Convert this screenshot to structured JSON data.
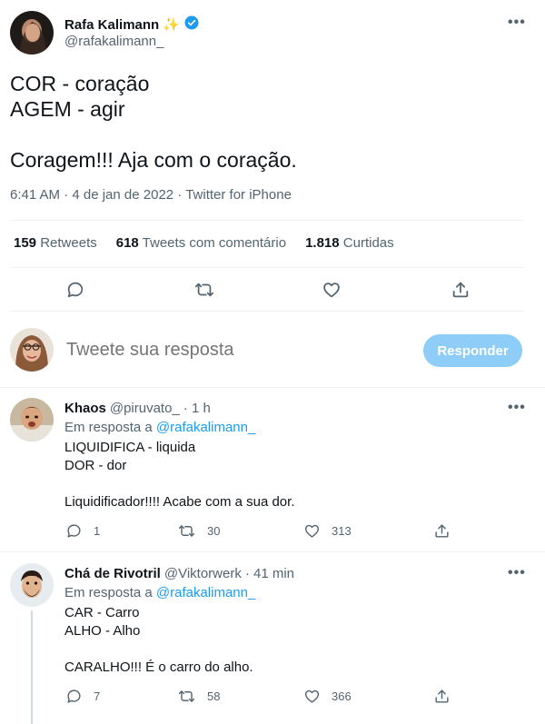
{
  "main_tweet": {
    "name": "Rafa Kalimann",
    "name_emoji": "✨",
    "handle": "@rafakalimann_",
    "text": "COR - coração\nAGEM - agir\n\nCoragem!!! Aja com o coração.",
    "timestamp": "6:41 AM · 4 de jan de 2022 · ",
    "source": "Twitter for iPhone",
    "stats": {
      "retweets_count": "159",
      "retweets_label": "Retweets",
      "quotes_count": "618",
      "quotes_label": "Tweets com comentário",
      "likes_count": "1.818",
      "likes_label": "Curtidas"
    }
  },
  "composer": {
    "placeholder": "Tweete sua resposta",
    "button_label": "Responder"
  },
  "replies": [
    {
      "name": "Khaos",
      "handle": "@piruvato_",
      "time": "· 1 h",
      "in_reply_prefix": "Em resposta a ",
      "in_reply_to": "@rafakalimann_",
      "text": "LIQUIDIFICA - liquida\nDOR - dor\n\nLiquidificador!!!! Acabe com a sua dor.",
      "replies": "1",
      "retweets": "30",
      "likes": "313"
    },
    {
      "name": "Chá de Rivotril",
      "handle": "@Viktorwerk",
      "time": "· 41 min",
      "in_reply_prefix": "Em resposta a ",
      "in_reply_to": "@rafakalimann_",
      "text": "CAR - Carro\nALHO - Alho\n\nCARALHO!!! É o carro do alho.",
      "replies": "7",
      "retweets": "58",
      "likes": "366"
    }
  ],
  "colors": {
    "accent": "#1d9bf0",
    "button_disabled": "#8ecdf8",
    "muted_text": "#536471",
    "divider": "#eff3f4"
  },
  "icons": [
    "more-icon",
    "verified-badge-icon",
    "reply-icon",
    "retweet-icon",
    "like-icon",
    "share-icon"
  ]
}
